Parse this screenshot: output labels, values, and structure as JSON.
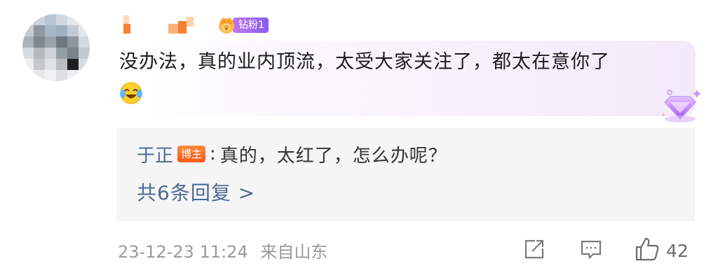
{
  "comment": {
    "badge_label": "钻粉1",
    "text": "没办法，真的业内顶流，太受大家关注了，都太在意你了",
    "emoji": "laugh-cry-emoji"
  },
  "reply": {
    "author": "于正",
    "host_tag": "博主",
    "separator": ":",
    "text": "真的，太红了，怎么办呢？"
  },
  "more_replies_label": "共6条回复 >",
  "meta": {
    "timestamp": "23-12-23 11:24",
    "location": "来自山东"
  },
  "actions": {
    "share_icon": "share-icon",
    "comment_icon": "comment-icon",
    "like_icon": "thumbs-up-icon",
    "like_count": "42"
  },
  "colors": {
    "link_blue": "#4d6a94",
    "host_tag_orange": "#f55a1b",
    "badge_purple": "#a96af0",
    "meta_gray": "#9a9a9a"
  }
}
